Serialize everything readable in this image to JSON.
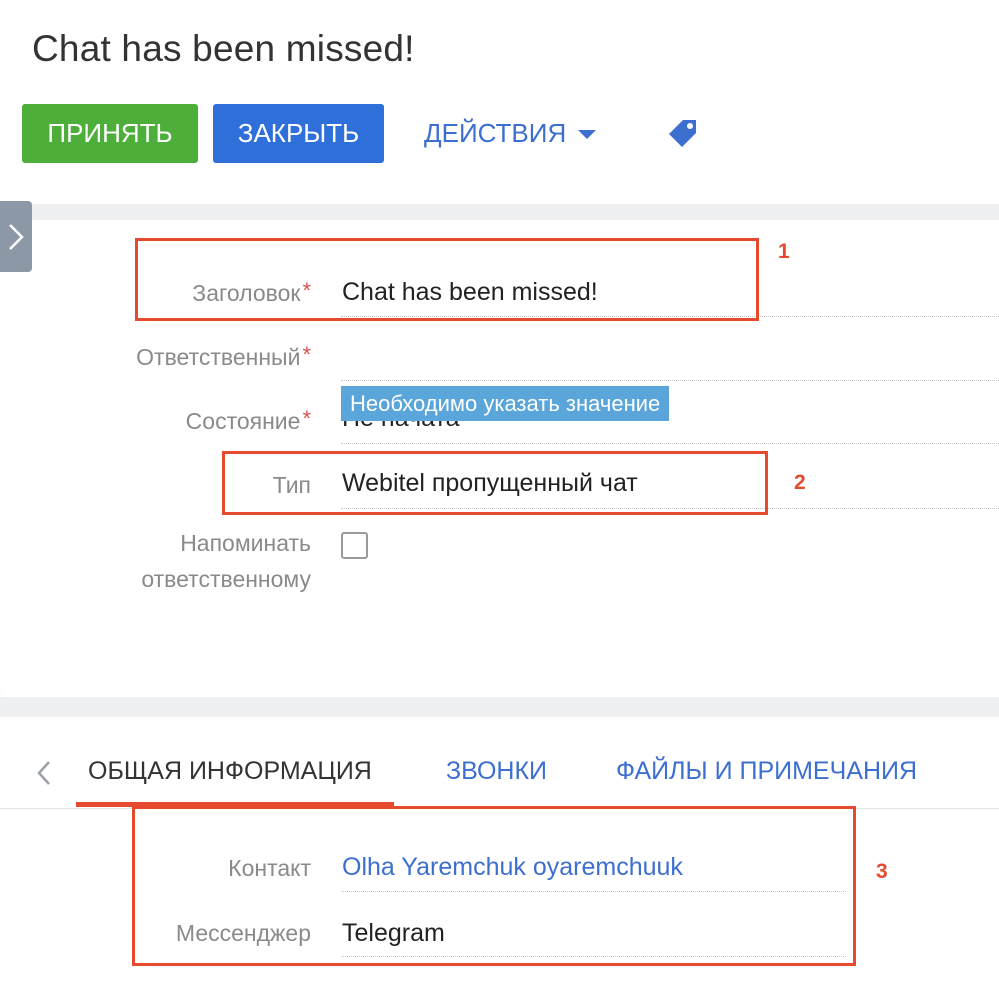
{
  "page": {
    "title": "Chat has been missed!"
  },
  "toolbar": {
    "accept_label": "ПРИНЯТЬ",
    "close_label": "ЗАКРЫТЬ",
    "actions_label": "ДЕЙСТВИЯ",
    "tag_icon": "tag-icon"
  },
  "form": {
    "title_label": "Заголовок",
    "title_value": "Chat has been missed!",
    "owner_label": "Ответственный",
    "owner_value": "",
    "state_label": "Состояние",
    "state_value": "Не начата",
    "type_label": "Тип",
    "type_value": "Webitel пропущенный чат",
    "remind_label_line1": "Напоминать",
    "remind_label_line2": "ответственному",
    "remind_checked": false,
    "required_mark": "*",
    "validation_tooltip": "Необходимо указать значение"
  },
  "tabs": {
    "items": [
      {
        "label": "ОБЩАЯ ИНФОРМАЦИЯ",
        "active": true
      },
      {
        "label": "ЗВОНКИ",
        "active": false
      },
      {
        "label": "ФАЙЛЫ И ПРИМЕЧАНИЯ",
        "active": false
      }
    ]
  },
  "details": {
    "contact_label": "Контакт",
    "contact_value": "Olha Yaremchuk oyaremchuuk",
    "messenger_label": "Мессенджер",
    "messenger_value": "Telegram"
  },
  "annotations": {
    "box1": "1",
    "box2": "2",
    "box3": "3"
  },
  "colors": {
    "accept": "#4eae3a",
    "close": "#2f6fd9",
    "link": "#3d6fd0",
    "annotation": "#e64a2e",
    "tooltip": "#5aa6da"
  }
}
